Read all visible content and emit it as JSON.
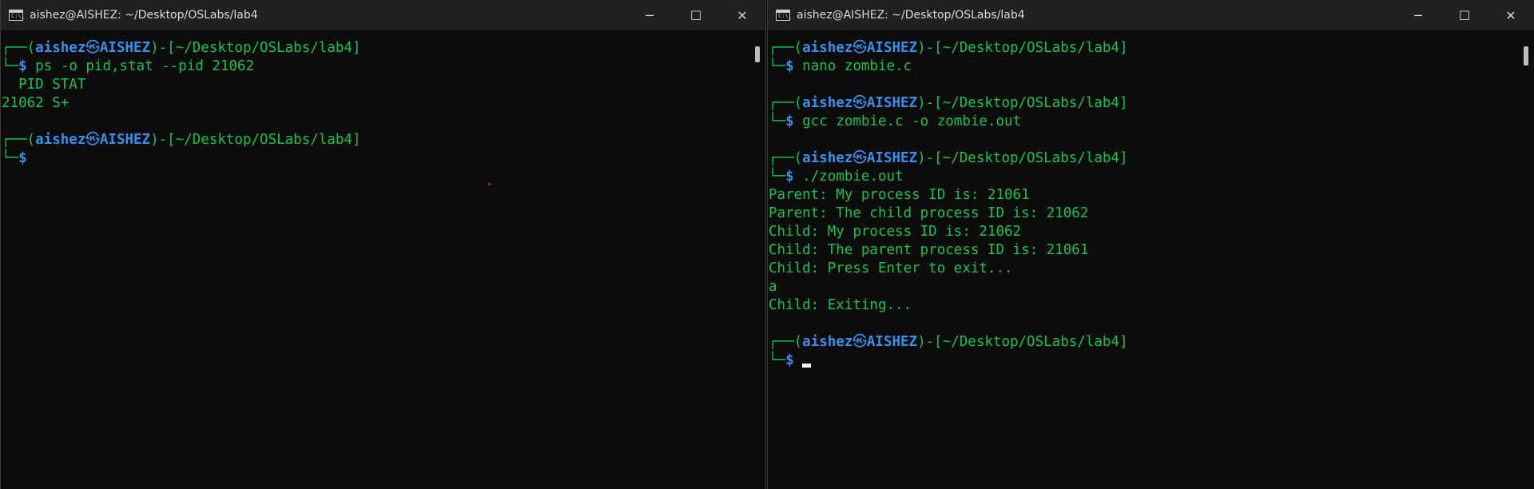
{
  "left": {
    "title": "aishez@AISHEZ: ~/Desktop/OSLabs/lab4",
    "icon_text": "C:\\_",
    "lines": [
      {
        "type": "prompt-top",
        "user": "aishez",
        "host": "AISHEZ",
        "path": "~/Desktop/OSLabs/lab4"
      },
      {
        "type": "prompt-cmd",
        "cmd": "ps -o pid,stat --pid 21062"
      },
      {
        "type": "out",
        "text": "  PID STAT"
      },
      {
        "type": "out",
        "text": "21062 S+"
      },
      {
        "type": "blank"
      },
      {
        "type": "prompt-top",
        "user": "aishez",
        "host": "AISHEZ",
        "path": "~/Desktop/OSLabs/lab4"
      },
      {
        "type": "prompt-cmd",
        "cmd": ""
      }
    ]
  },
  "right": {
    "title": "aishez@AISHEZ: ~/Desktop/OSLabs/lab4",
    "icon_text": "C:\\_",
    "lines": [
      {
        "type": "prompt-top",
        "user": "aishez",
        "host": "AISHEZ",
        "path": "~/Desktop/OSLabs/lab4"
      },
      {
        "type": "prompt-cmd",
        "cmd": "nano zombie.c"
      },
      {
        "type": "blank"
      },
      {
        "type": "prompt-top",
        "user": "aishez",
        "host": "AISHEZ",
        "path": "~/Desktop/OSLabs/lab4"
      },
      {
        "type": "prompt-cmd",
        "cmd": "gcc zombie.c -o zombie.out"
      },
      {
        "type": "blank"
      },
      {
        "type": "prompt-top",
        "user": "aishez",
        "host": "AISHEZ",
        "path": "~/Desktop/OSLabs/lab4"
      },
      {
        "type": "prompt-cmd",
        "cmd": "./zombie.out"
      },
      {
        "type": "out",
        "text": "Parent: My process ID is: 21061"
      },
      {
        "type": "out",
        "text": "Parent: The child process ID is: 21062"
      },
      {
        "type": "out",
        "text": "Child: My process ID is: 21062"
      },
      {
        "type": "out",
        "text": "Child: The parent process ID is: 21061"
      },
      {
        "type": "out",
        "text": "Child: Press Enter to exit..."
      },
      {
        "type": "out",
        "text": "a"
      },
      {
        "type": "out",
        "text": "Child: Exiting..."
      },
      {
        "type": "blank"
      },
      {
        "type": "prompt-top",
        "user": "aishez",
        "host": "AISHEZ",
        "path": "~/Desktop/OSLabs/lab4"
      },
      {
        "type": "prompt-cmd",
        "cmd": "",
        "cursor": true
      }
    ]
  },
  "caption_buttons": {
    "minimize": "─",
    "maximize": "☐",
    "close": "✕"
  },
  "prompt": {
    "corner_top": "┌──(",
    "corner_bottom": "└─",
    "dollar": "$",
    "at_symbol": "㉿",
    "path_open": ")-[",
    "path_close": "]"
  },
  "colors": {
    "green": "#19c34a",
    "blue": "#3b8eea",
    "titlebar": "#202020",
    "background": "#0c0c0c"
  }
}
